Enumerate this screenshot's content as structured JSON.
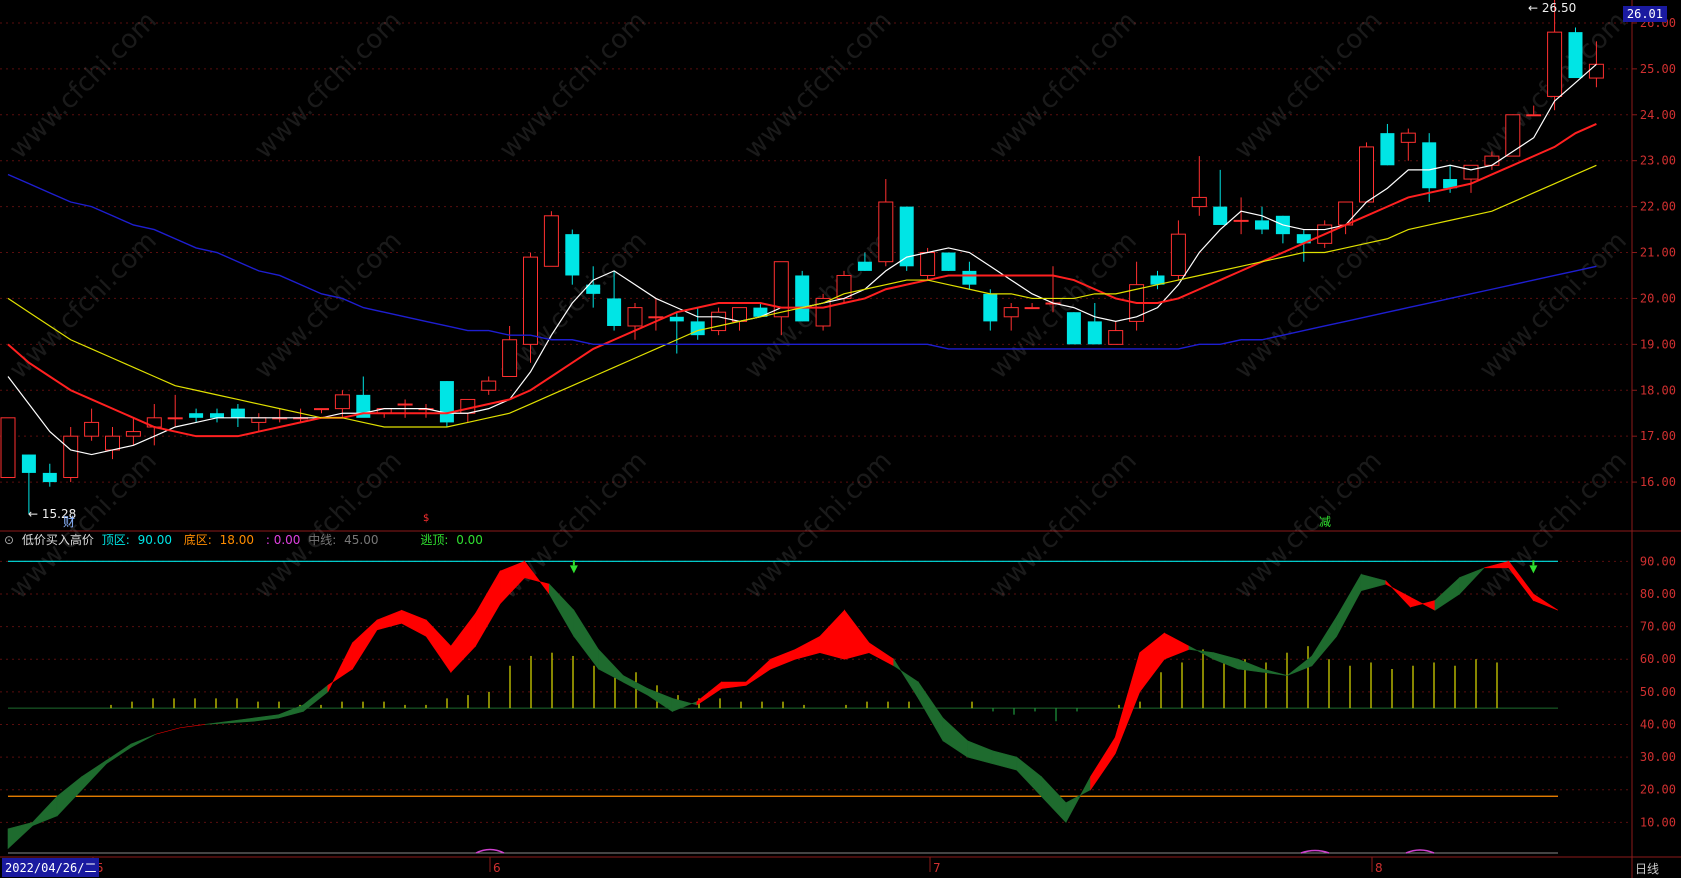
{
  "price_axis_labels": [
    "26.00",
    "25.00",
    "24.00",
    "23.00",
    "22.00",
    "21.00",
    "20.00",
    "19.00",
    "18.00",
    "17.00",
    "16.00"
  ],
  "current_price": "26.01",
  "high_label": "26.50",
  "low_label": "15.28",
  "event_marks": {
    "cai": "财",
    "s_mark": "$",
    "jian": "减"
  },
  "indicator": {
    "name": "低价买入高价",
    "top_zone_label": "顶区:",
    "top_zone_value": "90.00",
    "bottom_zone_label": "底区:",
    "bottom_zone_value": "18.00",
    "bottom_zone_extra": ": 0.00",
    "mid_label": "中线:",
    "mid_value": "45.00",
    "escape_label": "逃顶:",
    "escape_value": "0.00"
  },
  "indicator_axis_labels": [
    "90.00",
    "80.00",
    "70.00",
    "60.00",
    "50.00",
    "40.00",
    "30.00",
    "20.00",
    "10.00"
  ],
  "date_badge": "2022/04/26/二",
  "month_labels": [
    "5",
    "6",
    "7",
    "8"
  ],
  "period": "日线",
  "watermark": "www.cfchi.com",
  "colors": {
    "up": "#ff3030",
    "down": "#00e5e5",
    "ma5": "#ffffff",
    "ma10": "#ff2020",
    "ma20": "#e0e000",
    "ma60": "#1e1ed0",
    "indicator_up": "#ff0000",
    "indicator_down": "#1e6b2e",
    "top_line": "#00e5e5",
    "bottom_line": "#ff8c00",
    "histogram": "#e0e000"
  },
  "chart_data": {
    "type": "candlestick",
    "ylim": [
      15.0,
      26.5
    ],
    "candles": [
      [
        16.1,
        17.4,
        16.1,
        17.4
      ],
      [
        16.6,
        16.6,
        15.3,
        16.2
      ],
      [
        16.2,
        16.4,
        15.9,
        16.0
      ],
      [
        16.1,
        17.2,
        16.0,
        17.0
      ],
      [
        17.0,
        17.6,
        16.9,
        17.3
      ],
      [
        16.7,
        17.2,
        16.5,
        17.0
      ],
      [
        17.0,
        17.4,
        16.8,
        17.1
      ],
      [
        17.2,
        17.7,
        16.8,
        17.4
      ],
      [
        17.4,
        17.9,
        17.2,
        17.4
      ],
      [
        17.5,
        17.6,
        17.3,
        17.4
      ],
      [
        17.5,
        17.6,
        17.3,
        17.4
      ],
      [
        17.6,
        17.7,
        17.2,
        17.4
      ],
      [
        17.3,
        17.5,
        17.1,
        17.4
      ],
      [
        17.4,
        17.6,
        17.3,
        17.4
      ],
      [
        17.4,
        17.6,
        17.3,
        17.4
      ],
      [
        17.6,
        17.6,
        17.5,
        17.6
      ],
      [
        17.6,
        18.0,
        17.4,
        17.9
      ],
      [
        17.9,
        18.3,
        17.5,
        17.4
      ],
      [
        17.5,
        17.6,
        17.4,
        17.6
      ],
      [
        17.7,
        17.8,
        17.4,
        17.7
      ],
      [
        17.6,
        17.7,
        17.4,
        17.6
      ],
      [
        18.2,
        18.2,
        17.2,
        17.3
      ],
      [
        17.5,
        17.8,
        17.3,
        17.8
      ],
      [
        18.0,
        18.3,
        17.9,
        18.2
      ],
      [
        18.3,
        19.4,
        18.3,
        19.1
      ],
      [
        19.0,
        21.0,
        18.6,
        20.9
      ],
      [
        20.7,
        21.9,
        20.8,
        21.8
      ],
      [
        21.4,
        21.5,
        20.3,
        20.5
      ],
      [
        20.3,
        20.7,
        19.8,
        20.1
      ],
      [
        20.0,
        20.6,
        19.3,
        19.4
      ],
      [
        19.4,
        19.9,
        19.1,
        19.8
      ],
      [
        19.6,
        20.0,
        19.3,
        19.6
      ],
      [
        19.6,
        19.7,
        18.8,
        19.5
      ],
      [
        19.5,
        19.8,
        19.1,
        19.2
      ],
      [
        19.3,
        19.8,
        19.2,
        19.7
      ],
      [
        19.5,
        19.8,
        19.3,
        19.8
      ],
      [
        19.8,
        19.9,
        19.6,
        19.6
      ],
      [
        19.6,
        20.8,
        19.2,
        20.8
      ],
      [
        20.5,
        20.6,
        19.5,
        19.5
      ],
      [
        19.4,
        20.1,
        19.3,
        20.0
      ],
      [
        20.0,
        20.6,
        19.9,
        20.5
      ],
      [
        20.8,
        21.0,
        20.6,
        20.6
      ],
      [
        20.8,
        22.6,
        20.7,
        22.1
      ],
      [
        22.0,
        22.0,
        20.6,
        20.7
      ],
      [
        20.5,
        21.1,
        20.4,
        21.0
      ],
      [
        21.0,
        21.0,
        20.6,
        20.6
      ],
      [
        20.6,
        20.8,
        20.2,
        20.3
      ],
      [
        20.1,
        20.2,
        19.3,
        19.5
      ],
      [
        19.6,
        19.9,
        19.3,
        19.8
      ],
      [
        19.8,
        19.9,
        19.8,
        19.8
      ],
      [
        19.9,
        20.7,
        19.7,
        19.9
      ],
      [
        19.7,
        19.7,
        19.1,
        19.0
      ],
      [
        19.5,
        19.9,
        19.0,
        19.0
      ],
      [
        19.0,
        19.5,
        19.0,
        19.3
      ],
      [
        19.5,
        20.8,
        19.3,
        20.3
      ],
      [
        20.5,
        20.6,
        20.2,
        20.3
      ],
      [
        20.5,
        21.7,
        20.4,
        21.4
      ],
      [
        22.0,
        23.1,
        21.8,
        22.2
      ],
      [
        22.0,
        22.8,
        21.6,
        21.6
      ],
      [
        21.7,
        22.2,
        21.4,
        21.7
      ],
      [
        21.7,
        22.0,
        21.4,
        21.5
      ],
      [
        21.8,
        21.8,
        21.2,
        21.4
      ],
      [
        21.4,
        21.5,
        20.8,
        21.2
      ],
      [
        21.2,
        21.7,
        21.1,
        21.6
      ],
      [
        21.6,
        22.1,
        21.4,
        22.1
      ],
      [
        22.1,
        23.4,
        22.1,
        23.3
      ],
      [
        23.6,
        23.8,
        22.9,
        22.9
      ],
      [
        23.4,
        23.7,
        23.0,
        23.6
      ],
      [
        23.4,
        23.6,
        22.1,
        22.4
      ],
      [
        22.6,
        22.9,
        22.3,
        22.4
      ],
      [
        22.6,
        22.9,
        22.3,
        22.9
      ],
      [
        22.9,
        23.2,
        22.8,
        23.1
      ],
      [
        23.1,
        24.0,
        23.1,
        24.0
      ],
      [
        24.0,
        24.2,
        24.0,
        24.0
      ],
      [
        24.4,
        26.5,
        24.1,
        25.8
      ],
      [
        25.8,
        25.9,
        24.9,
        24.8
      ],
      [
        24.8,
        25.6,
        24.6,
        25.1
      ]
    ],
    "ma_series": [
      {
        "name": "MA5",
        "color": "#ffffff",
        "values": [
          18.3,
          17.7,
          17.1,
          16.7,
          16.6,
          16.7,
          16.8,
          17.0,
          17.2,
          17.3,
          17.4,
          17.4,
          17.4,
          17.4,
          17.4,
          17.4,
          17.5,
          17.5,
          17.6,
          17.6,
          17.6,
          17.5,
          17.5,
          17.6,
          17.8,
          18.4,
          19.2,
          19.9,
          20.4,
          20.6,
          20.3,
          20.0,
          19.8,
          19.6,
          19.6,
          19.5,
          19.6,
          19.8,
          19.8,
          19.9,
          20.0,
          20.2,
          20.6,
          20.9,
          21.0,
          21.1,
          21.0,
          20.7,
          20.4,
          20.1,
          19.9,
          19.8,
          19.6,
          19.5,
          19.6,
          19.8,
          20.3,
          21.0,
          21.5,
          21.9,
          21.8,
          21.6,
          21.5,
          21.5,
          21.6,
          22.1,
          22.4,
          22.8,
          22.8,
          22.9,
          22.8,
          22.9,
          23.2,
          23.5,
          24.3,
          24.7,
          25.1
        ]
      },
      {
        "name": "MA10",
        "color": "#ff2020",
        "values": [
          19.0,
          18.6,
          18.3,
          18.0,
          17.8,
          17.6,
          17.4,
          17.2,
          17.1,
          17.0,
          17.0,
          17.0,
          17.1,
          17.2,
          17.3,
          17.4,
          17.4,
          17.5,
          17.5,
          17.5,
          17.5,
          17.5,
          17.6,
          17.7,
          17.8,
          18.0,
          18.3,
          18.6,
          18.9,
          19.1,
          19.3,
          19.5,
          19.7,
          19.8,
          19.9,
          19.9,
          19.9,
          19.8,
          19.8,
          19.8,
          19.9,
          20.0,
          20.2,
          20.3,
          20.4,
          20.5,
          20.5,
          20.5,
          20.5,
          20.5,
          20.5,
          20.4,
          20.2,
          20.0,
          19.9,
          19.9,
          20.0,
          20.2,
          20.4,
          20.6,
          20.8,
          21.0,
          21.2,
          21.4,
          21.6,
          21.8,
          22.0,
          22.2,
          22.3,
          22.4,
          22.5,
          22.7,
          22.9,
          23.1,
          23.3,
          23.6,
          23.8
        ]
      },
      {
        "name": "MA20",
        "color": "#e0e000",
        "values": [
          20.0,
          19.7,
          19.4,
          19.1,
          18.9,
          18.7,
          18.5,
          18.3,
          18.1,
          18.0,
          17.9,
          17.8,
          17.7,
          17.6,
          17.5,
          17.4,
          17.4,
          17.3,
          17.2,
          17.2,
          17.2,
          17.2,
          17.3,
          17.4,
          17.5,
          17.7,
          17.9,
          18.1,
          18.3,
          18.5,
          18.7,
          18.9,
          19.1,
          19.3,
          19.4,
          19.5,
          19.6,
          19.7,
          19.8,
          19.9,
          20.1,
          20.2,
          20.3,
          20.4,
          20.4,
          20.3,
          20.2,
          20.1,
          20.1,
          20.0,
          20.0,
          20.0,
          20.1,
          20.1,
          20.2,
          20.3,
          20.4,
          20.5,
          20.6,
          20.7,
          20.8,
          20.9,
          21.0,
          21.0,
          21.1,
          21.2,
          21.3,
          21.5,
          21.6,
          21.7,
          21.8,
          21.9,
          22.1,
          22.3,
          22.5,
          22.7,
          22.9
        ]
      },
      {
        "name": "MA60",
        "color": "#1e1ed0",
        "values": [
          22.7,
          22.5,
          22.3,
          22.1,
          22.0,
          21.8,
          21.6,
          21.5,
          21.3,
          21.1,
          21.0,
          20.8,
          20.6,
          20.5,
          20.3,
          20.1,
          20.0,
          19.8,
          19.7,
          19.6,
          19.5,
          19.4,
          19.3,
          19.3,
          19.2,
          19.2,
          19.1,
          19.1,
          19.0,
          19.0,
          19.0,
          19.0,
          19.0,
          19.0,
          19.0,
          19.0,
          19.0,
          19.0,
          19.0,
          19.0,
          19.0,
          19.0,
          19.0,
          19.0,
          19.0,
          18.9,
          18.9,
          18.9,
          18.9,
          18.9,
          18.9,
          18.9,
          18.9,
          18.9,
          18.9,
          18.9,
          18.9,
          19.0,
          19.0,
          19.1,
          19.1,
          19.2,
          19.3,
          19.4,
          19.5,
          19.6,
          19.7,
          19.8,
          19.9,
          20.0,
          20.1,
          20.2,
          20.3,
          20.4,
          20.5,
          20.6,
          20.7
        ]
      }
    ],
    "indicator_data": {
      "ylim": [
        0,
        95
      ],
      "top_zone": 90,
      "bottom_zone": 18,
      "mid_line": 45,
      "fast": [
        2,
        9,
        12,
        20,
        28,
        33,
        37,
        39,
        40,
        40.5,
        41,
        42,
        44,
        50,
        65,
        72,
        75,
        72,
        64,
        74,
        87,
        90,
        80,
        67,
        57,
        53,
        49,
        44,
        47,
        53,
        53,
        60,
        63,
        67,
        75,
        65,
        60,
        48,
        35,
        30,
        28,
        26,
        18,
        10,
        24,
        36,
        62,
        68,
        64,
        60,
        57,
        56,
        55,
        58,
        67,
        81,
        83,
        79,
        75,
        80,
        88,
        90,
        80,
        75
      ],
      "slow": [
        8,
        10,
        18,
        24,
        29,
        34,
        37,
        39,
        40,
        41,
        42,
        43,
        46,
        52,
        57,
        69,
        71,
        67,
        56,
        64,
        77,
        85,
        83,
        75,
        63,
        55,
        51,
        48,
        46,
        51,
        52,
        57,
        60,
        62,
        60,
        62,
        58,
        53,
        42,
        35,
        32,
        30,
        24,
        16,
        20,
        31,
        50,
        60,
        63,
        62,
        60,
        57,
        55,
        61,
        73,
        86,
        84,
        76,
        78,
        85,
        88,
        88,
        78,
        75
      ],
      "histogram": [
        45,
        45,
        45,
        45,
        46,
        47,
        48,
        48,
        48,
        48,
        48,
        47,
        47,
        46,
        46,
        47,
        47,
        47,
        46,
        46,
        48,
        49,
        50,
        58,
        61,
        62,
        61,
        58,
        57,
        56,
        52,
        49,
        48,
        48,
        47,
        47,
        47,
        46,
        45,
        46,
        47,
        47,
        47,
        46,
        45,
        47,
        44,
        43,
        44,
        41,
        44,
        45,
        46,
        47,
        56,
        59,
        63,
        61,
        60,
        59,
        62,
        64,
        60,
        58,
        59,
        57,
        58,
        59,
        58,
        60,
        59
      ],
      "sell_arrows_at": [
        23,
        62,
        70
      ],
      "legend_values": {
        "top": 90,
        "bottom": 18,
        "mid": 45,
        "escape": 0
      }
    }
  }
}
